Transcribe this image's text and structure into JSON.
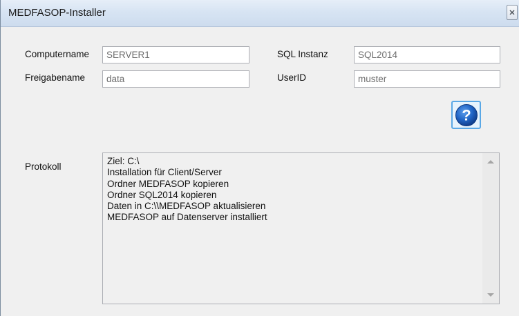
{
  "window": {
    "title": "MEDFASOP-Installer",
    "close_symbol": "×"
  },
  "form": {
    "computername_label": "Computername",
    "computername_value": "SERVER1",
    "freigabename_label": "Freigabename",
    "freigabename_value": "data",
    "sql_instanz_label": "SQL Instanz",
    "sql_instanz_value": "SQL2014",
    "userid_label": "UserID",
    "userid_value": "muster"
  },
  "help": {
    "icon": "question-mark-icon",
    "symbol": "?",
    "accent": "#1f63c4"
  },
  "protokoll": {
    "label": "Protokoll",
    "lines": [
      "Ziel: C:\\",
      "Installation für Client/Server",
      "Ordner MEDFASOP kopieren",
      "Ordner SQL2014 kopieren",
      "Daten in C:\\\\MEDFASOP aktualisieren",
      "MEDFASOP auf Datenserver installiert"
    ]
  }
}
